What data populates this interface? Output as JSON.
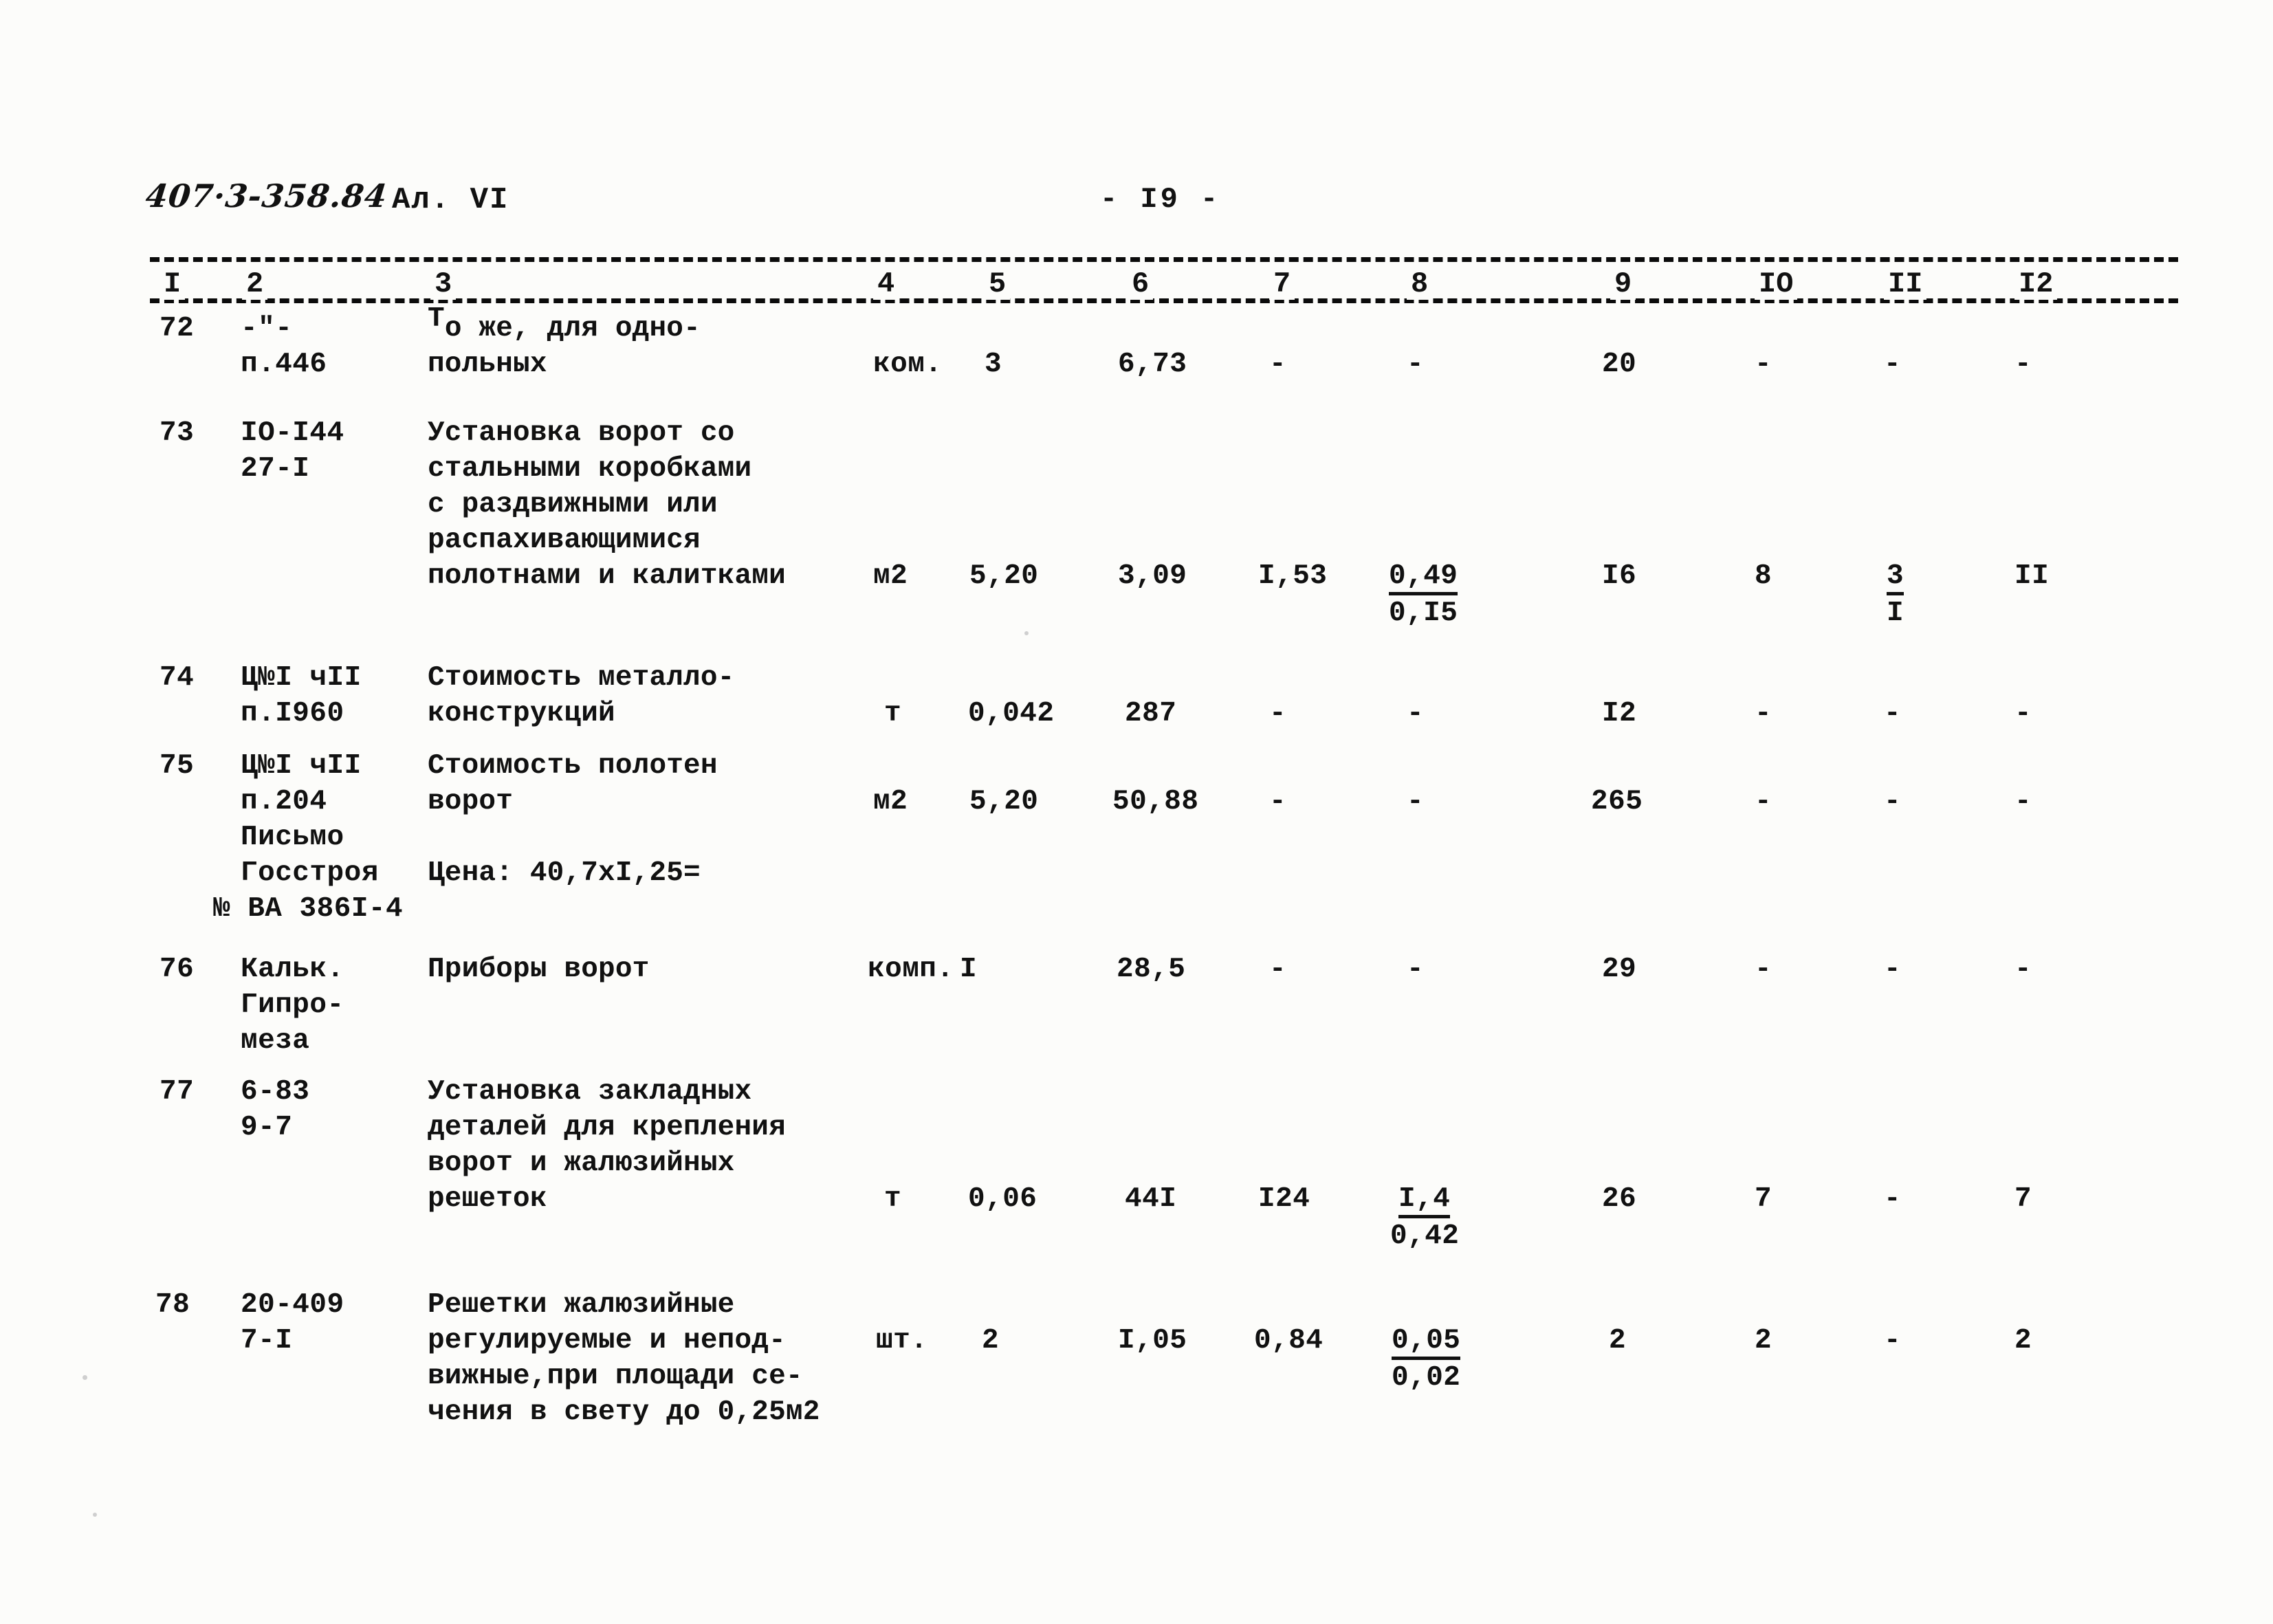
{
  "header": {
    "doc_code": "407·3-358.84",
    "album": "Ал. VI",
    "page_number": "- I9 -"
  },
  "table": {
    "column_numbers": [
      "I",
      "2",
      "3",
      "4",
      "5",
      "6",
      "7",
      "8",
      "9",
      "IO",
      "II",
      "I2"
    ],
    "rows": [
      {
        "pos": "72",
        "code_lines": [
          "-\"-",
          "п.446"
        ],
        "desc_lines": [
          "То же, для одно-",
          "польных"
        ],
        "unit": "ком.",
        "c5": "3",
        "c6": "6,73",
        "c7": "-",
        "c8_top": "-",
        "c8_bottom": "",
        "c9": "20",
        "c10": "-",
        "c11_top": "-",
        "c11_bottom": "",
        "c12": "-"
      },
      {
        "pos": "73",
        "code_lines": [
          "IO-I44",
          "27-I"
        ],
        "desc_lines": [
          "Установка ворот со",
          "стальными коробками",
          "с раздвижными или",
          "распахивающимися",
          "полотнами и калитками"
        ],
        "unit": "м2",
        "c5": "5,20",
        "c6": "3,09",
        "c7": "I,53",
        "c8_top": "0,49",
        "c8_bottom": "0,I5",
        "c9": "I6",
        "c10": "8",
        "c11_top": "3",
        "c11_bottom": "I",
        "c12": "II"
      },
      {
        "pos": "74",
        "code_lines": [
          "Ц№I чII",
          "п.I960"
        ],
        "desc_lines": [
          "Стоимость металло-",
          "конструкций"
        ],
        "unit": "т",
        "c5": "0,042",
        "c6": "287",
        "c7": "-",
        "c8_top": "-",
        "c8_bottom": "",
        "c9": "I2",
        "c10": "-",
        "c11_top": "-",
        "c11_bottom": "",
        "c12": "-"
      },
      {
        "pos": "75",
        "code_lines": [
          "Ц№I чII",
          "п.204",
          "Письмо",
          "Госстроя",
          "№ ВА 386I-4"
        ],
        "desc_lines": [
          "Стоимость полотен",
          "ворот",
          "",
          "Цена: 40,7хI,25="
        ],
        "unit": "м2",
        "c5": "5,20",
        "c6": "50,88",
        "c7": "-",
        "c8_top": "-",
        "c8_bottom": "",
        "c9": "265",
        "c10": "-",
        "c11_top": "-",
        "c11_bottom": "",
        "c12": "-"
      },
      {
        "pos": "76",
        "code_lines": [
          "Кальк.",
          "Гипро-",
          "меза"
        ],
        "desc_lines": [
          "Приборы ворот"
        ],
        "unit": "комп.",
        "c5": "I",
        "c6": "28,5",
        "c7": "-",
        "c8_top": "-",
        "c8_bottom": "",
        "c9": "29",
        "c10": "-",
        "c11_top": "-",
        "c11_bottom": "",
        "c12": "-"
      },
      {
        "pos": "77",
        "code_lines": [
          "6-83",
          "9-7"
        ],
        "desc_lines": [
          "Установка закладных",
          "деталей для крепления",
          "ворот и жалюзийных",
          "решеток"
        ],
        "unit": "т",
        "c5": "0,06",
        "c6": "44I",
        "c7": "I24",
        "c8_top": "I,4",
        "c8_bottom": "0,42",
        "c9": "26",
        "c10": "7",
        "c11_top": "-",
        "c11_bottom": "",
        "c12": "7"
      },
      {
        "pos": "78",
        "code_lines": [
          "20-409",
          "7-I"
        ],
        "desc_lines": [
          "Решетки жалюзийные",
          "регулируемые и непод-",
          "вижные,при площади се-",
          "чения в свету до 0,25м2"
        ],
        "unit": "шт.",
        "c5": "2",
        "c6": "I,05",
        "c7": "0,84",
        "c8_top": "0,05",
        "c8_bottom": "0,02",
        "c9": "2",
        "c10": "2",
        "c11_top": "-",
        "c11_bottom": "",
        "c12": "2"
      }
    ]
  }
}
